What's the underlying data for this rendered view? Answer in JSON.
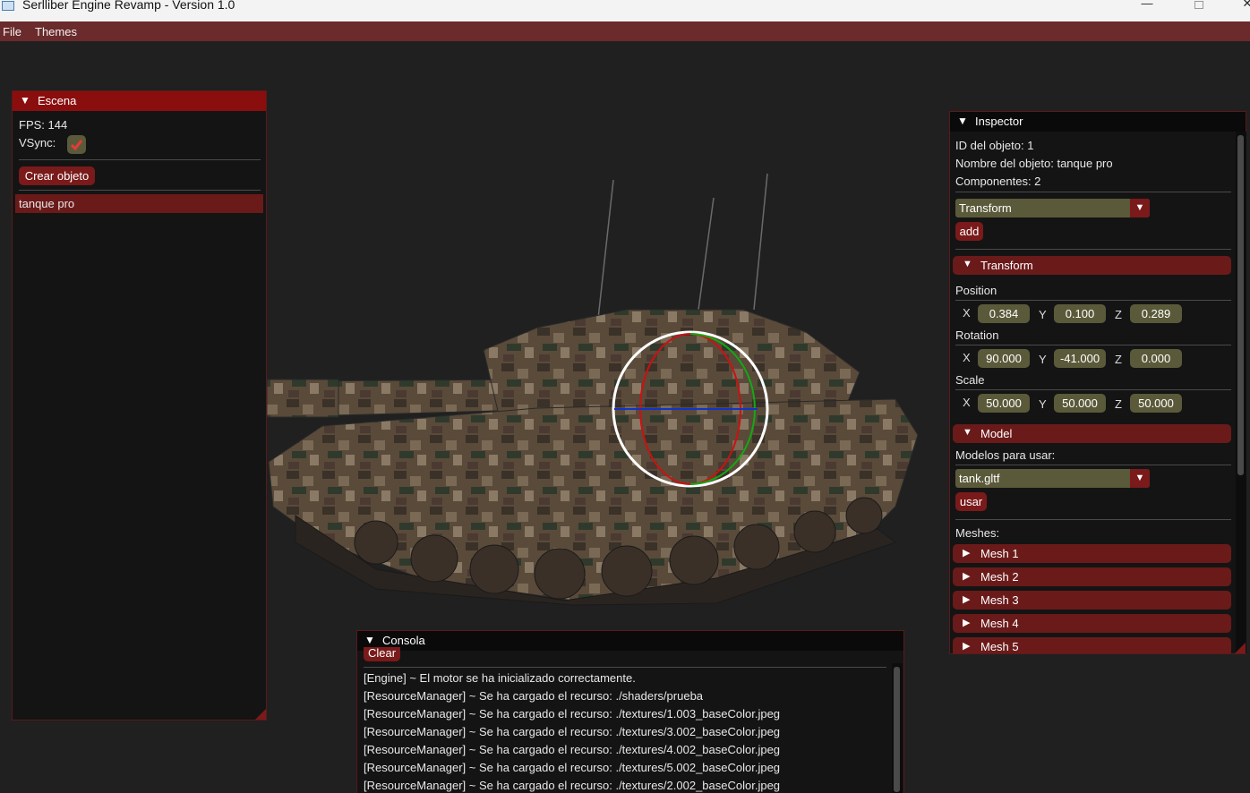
{
  "window": {
    "title": "Serlliber Engine Revamp - Version 1.0",
    "minimize": "—",
    "close": "✕"
  },
  "menubar": {
    "items": [
      "File",
      "Themes"
    ]
  },
  "escena": {
    "title": "Escena",
    "fps_label": "FPS: 144",
    "vsync_label": "VSync:",
    "vsync_checked": true,
    "create_button": "Crear objeto",
    "objects": [
      "tanque pro"
    ]
  },
  "inspector": {
    "title": "Inspector",
    "object_id": "ID del objeto: 1",
    "object_name": "Nombre del objeto: tanque pro",
    "components": "Componentes: 2",
    "component_select": "Transform",
    "add_button": "add",
    "transform": {
      "header": "Transform",
      "position_label": "Position",
      "rotation_label": "Rotation",
      "scale_label": "Scale",
      "axis": {
        "x": "X",
        "y": "Y",
        "z": "Z"
      },
      "position": {
        "x": "0.384",
        "y": "0.100",
        "z": "0.289"
      },
      "rotation": {
        "x": "90.000",
        "y": "-41.000",
        "z": "0.000"
      },
      "scale": {
        "x": "50.000",
        "y": "50.000",
        "z": "50.000"
      }
    },
    "model": {
      "header": "Model",
      "models_label": "Modelos para usar:",
      "model_select": "tank.gltf",
      "use_button": "usar",
      "meshes_label": "Meshes:",
      "meshes": [
        "Mesh 1",
        "Mesh 2",
        "Mesh 3",
        "Mesh 4",
        "Mesh 5"
      ]
    }
  },
  "console": {
    "title": "Consola",
    "clear_button": "Clear",
    "lines": [
      "[Engine] ~ El motor se ha inicializado correctamente.",
      "[ResourceManager] ~ Se ha cargado el recurso: ./shaders/prueba",
      "[ResourceManager] ~ Se ha cargado el recurso: ./textures/1.003_baseColor.jpeg",
      "[ResourceManager] ~ Se ha cargado el recurso: ./textures/3.002_baseColor.jpeg",
      "[ResourceManager] ~ Se ha cargado el recurso: ./textures/4.002_baseColor.jpeg",
      "[ResourceManager] ~ Se ha cargado el recurso: ./textures/5.002_baseColor.jpeg",
      "[ResourceManager] ~ Se ha cargado el recurso: ./textures/2.002_baseColor.jpeg"
    ]
  },
  "colors": {
    "accent": "#8b0e0e",
    "menubar": "#6b2a2b",
    "field": "#5a5a3a",
    "gizmo_x": "#cc1111",
    "gizmo_y": "#11aa11",
    "gizmo_z": "#1133cc"
  }
}
